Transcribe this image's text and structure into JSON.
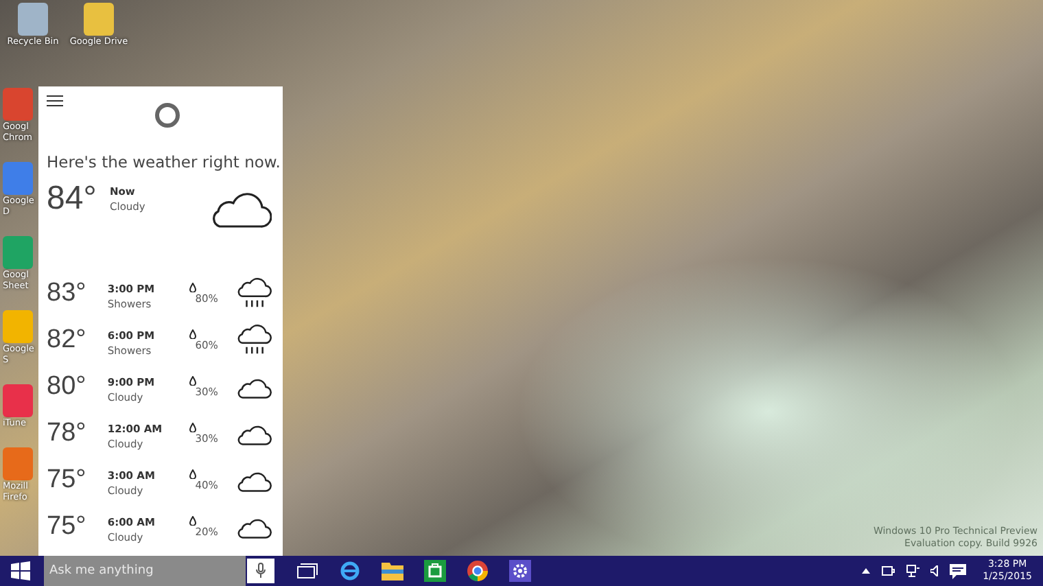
{
  "desktop_icons": [
    {
      "kind": "recycle",
      "label": "Recycle Bin"
    },
    {
      "kind": "drive",
      "label": "Google Drive"
    }
  ],
  "desktop_icons_left": [
    {
      "kind": "chrome",
      "label": "Googl Chrom"
    },
    {
      "kind": "docs",
      "label": "Google D"
    },
    {
      "kind": "sheets",
      "label": "Googl Sheet"
    },
    {
      "kind": "slides",
      "label": "Google S"
    },
    {
      "kind": "itunes",
      "label": "iTune"
    },
    {
      "kind": "firefox",
      "label": "Mozill Firefo"
    }
  ],
  "cortana": {
    "heading": "Here's the weather right now.",
    "current": {
      "temp": "84°",
      "time": "Now",
      "condition": "Cloudy"
    },
    "forecast": [
      {
        "temp": "83°",
        "time": "3:00 PM",
        "condition": "Showers",
        "precip": "80%",
        "kind": "rain"
      },
      {
        "temp": "82°",
        "time": "6:00 PM",
        "condition": "Showers",
        "precip": "60%",
        "kind": "rain"
      },
      {
        "temp": "80°",
        "time": "9:00 PM",
        "condition": "Cloudy",
        "precip": "30%",
        "kind": "cloud"
      },
      {
        "temp": "78°",
        "time": "12:00 AM",
        "condition": "Cloudy",
        "precip": "30%",
        "kind": "cloud"
      },
      {
        "temp": "75°",
        "time": "3:00 AM",
        "condition": "Cloudy",
        "precip": "40%",
        "kind": "cloud"
      },
      {
        "temp": "75°",
        "time": "6:00 AM",
        "condition": "Cloudy",
        "precip": "20%",
        "kind": "cloud"
      }
    ]
  },
  "system_text": [
    "Windows 10 Pro Technical Preview",
    "Evaluation copy. Build 9926"
  ],
  "taskbar": {
    "search": {
      "placeholder": "Ask me anything"
    },
    "apps": [
      {
        "kind": "taskview"
      },
      {
        "kind": "ie"
      },
      {
        "kind": "explorer"
      },
      {
        "kind": "store"
      },
      {
        "kind": "chrome"
      },
      {
        "kind": "settings"
      }
    ],
    "clock": {
      "time": "3:28 PM",
      "date": "1/25/2015"
    }
  }
}
